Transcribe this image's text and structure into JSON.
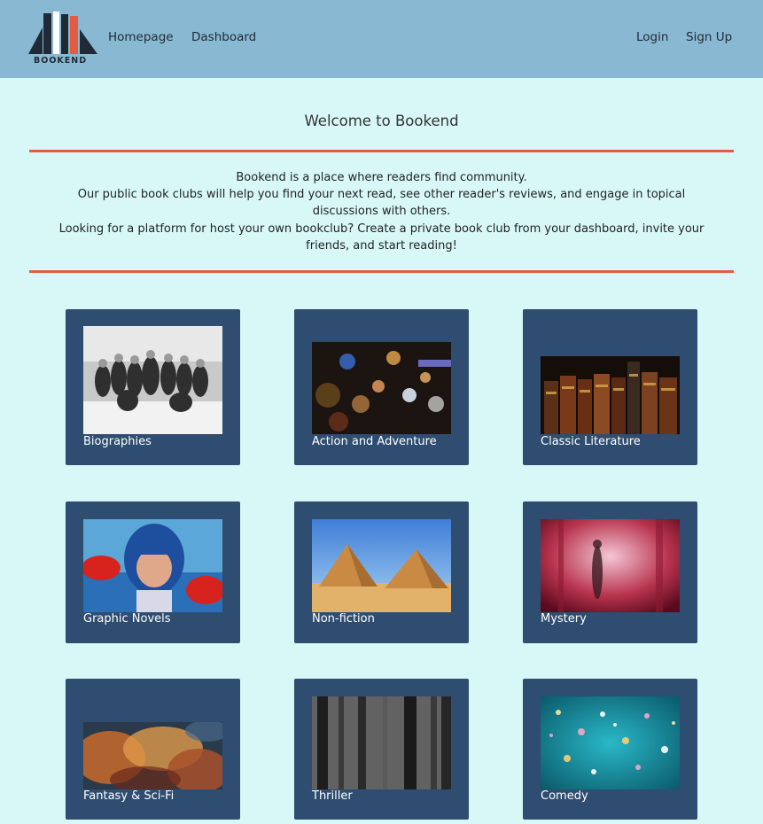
{
  "brand": {
    "logo_text": "BOOKEND"
  },
  "nav": {
    "homepage": "Homepage",
    "dashboard": "Dashboard",
    "login": "Login",
    "signup": "Sign Up"
  },
  "welcome": "Welcome to Bookend",
  "intro": {
    "line1": "Bookend is a place where readers find community.",
    "line2": "Our public book clubs will help you find your next read, see other reader's reviews, and engage in topical discussions with others.",
    "line3": "Looking for a platform for host your own bookclub? Create a private book club from your dashboard, invite your friends, and start reading!"
  },
  "genres": [
    {
      "label": "Biographies"
    },
    {
      "label": "Action and Adventure"
    },
    {
      "label": "Classic Literature"
    },
    {
      "label": "Graphic Novels"
    },
    {
      "label": "Non-fiction"
    },
    {
      "label": "Mystery"
    },
    {
      "label": "Fantasy & Sci-Fi"
    },
    {
      "label": "Thriller"
    },
    {
      "label": "Comedy"
    }
  ],
  "colors": {
    "navbar": "#89b9d2",
    "background": "#d8f8f8",
    "divider": "#e55a43",
    "card": "#2e4d70"
  }
}
